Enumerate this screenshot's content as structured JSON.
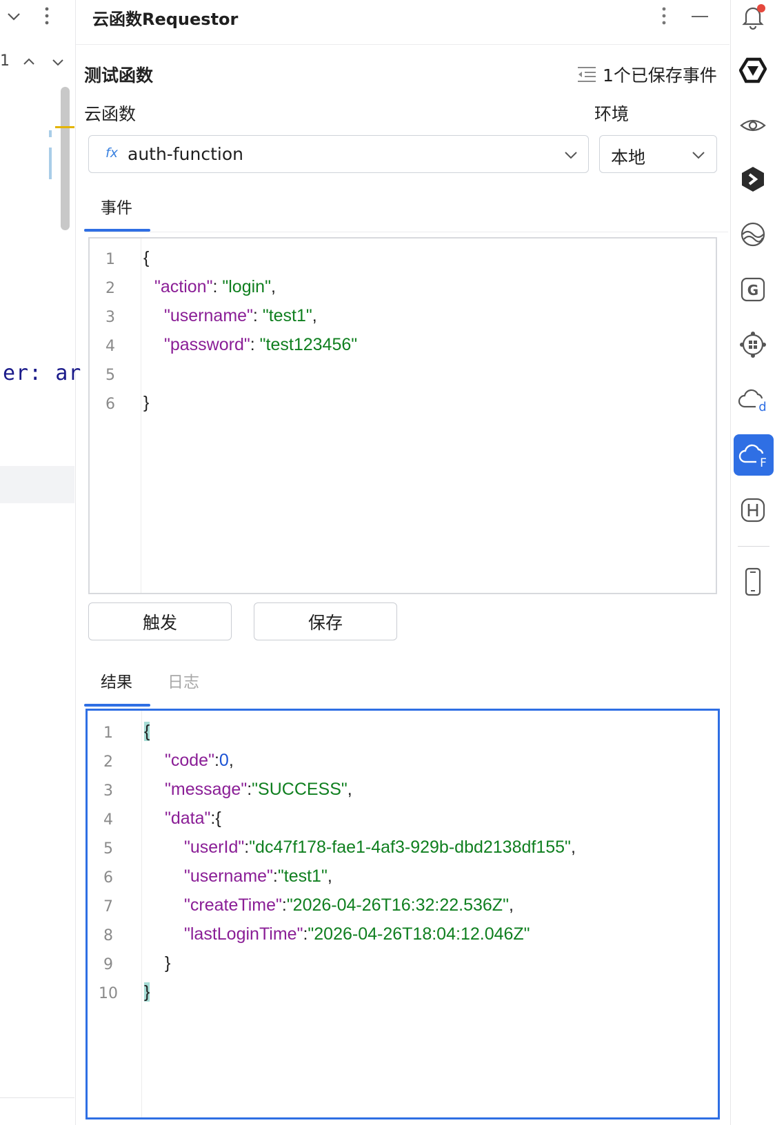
{
  "left_editor": {
    "line_number": "1",
    "code_snippet": "er: ar"
  },
  "panel": {
    "title": "云函数Requestor"
  },
  "test_section": {
    "heading": "测试函数",
    "saved_events_label": "1个已保存事件",
    "function_label": "云函数",
    "env_label": "环境",
    "function_icon_text": "fx",
    "function_value": "auth-function",
    "env_value": "本地"
  },
  "event_tab": {
    "label": "事件"
  },
  "event_editor": {
    "line_numbers": [
      "1",
      "2",
      "3",
      "4",
      "5",
      "6"
    ]
  },
  "buttons": {
    "trigger": "触发",
    "save": "保存"
  },
  "result_tabs": {
    "result": "结果",
    "log": "日志"
  },
  "result_editor": {
    "line_numbers": [
      "1",
      "2",
      "3",
      "4",
      "5",
      "6",
      "7",
      "8",
      "9",
      "10"
    ]
  },
  "colors": {
    "accent": "#2f6fe4",
    "json_key": "#8a1e96",
    "json_string": "#0f7f1f",
    "json_number": "#1a52d4",
    "notification_dot": "#e5483d"
  },
  "icons": {
    "right_toolbar": [
      "bell-icon",
      "tongyi-logo-icon",
      "eye-icon",
      "hexagon-plugin-icon",
      "globe-wave-icon",
      "g-badge-icon",
      "cube-network-icon",
      "cloud-d-icon",
      "cloud-function-icon",
      "h-badge-icon",
      "phone-icon"
    ]
  }
}
